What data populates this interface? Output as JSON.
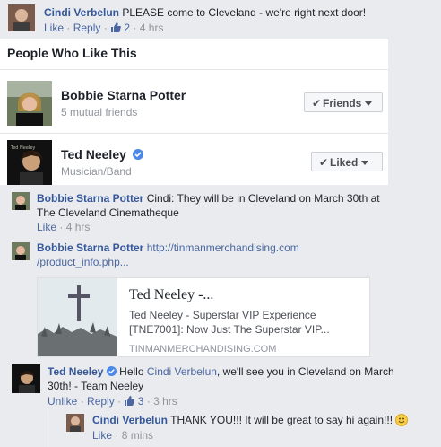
{
  "top_comment": {
    "author": "Cindi Verbelun",
    "text": "PLEASE come to Cleveland - we're right next door!",
    "like": "Like",
    "reply": "Reply",
    "likes_count": "2",
    "time": "4 hrs"
  },
  "people_like": {
    "title": "People Who Like This",
    "people": [
      {
        "name": "Bobbie Starna Potter",
        "sub": "5 mutual friends",
        "button": "Friends"
      },
      {
        "name": "Ted Neeley",
        "sub": "Musician/Band",
        "button": "Liked"
      }
    ]
  },
  "replies": [
    {
      "author": "Bobbie Starna Potter",
      "text": "Cindi: They will be in Cleveland on March 30th at The Cleveland Cinematheque",
      "like": "Like",
      "time": "4 hrs"
    },
    {
      "author": "Bobbie Starna Potter",
      "link_line1": "http://tinmanmerchandising.com",
      "link_line2": "/product_info.php...",
      "preview": {
        "title": "Ted Neeley -...",
        "desc_line1": "Ted Neeley - Superstar VIP Experience",
        "desc_line2": "[TNE7001]: Now Just The Superstar VIP...",
        "domain": "TINMANMERCHANDISING.COM"
      }
    },
    {
      "author": "Ted Neeley",
      "text_prefix": "Hello ",
      "mention": "Cindi Verbelun",
      "text_line1_suffix": ", we'll see you in Cleveland on March",
      "text_line2": "30th! - Team Neeley",
      "unlike": "Unlike",
      "reply": "Reply",
      "likes_count": "3",
      "time": "3 hrs"
    }
  ],
  "nested_reply": {
    "author": "Cindi Verbelun",
    "text": "THANK YOU!!! It will be great to say hi again!!!",
    "like": "Like",
    "time": "8 mins"
  }
}
